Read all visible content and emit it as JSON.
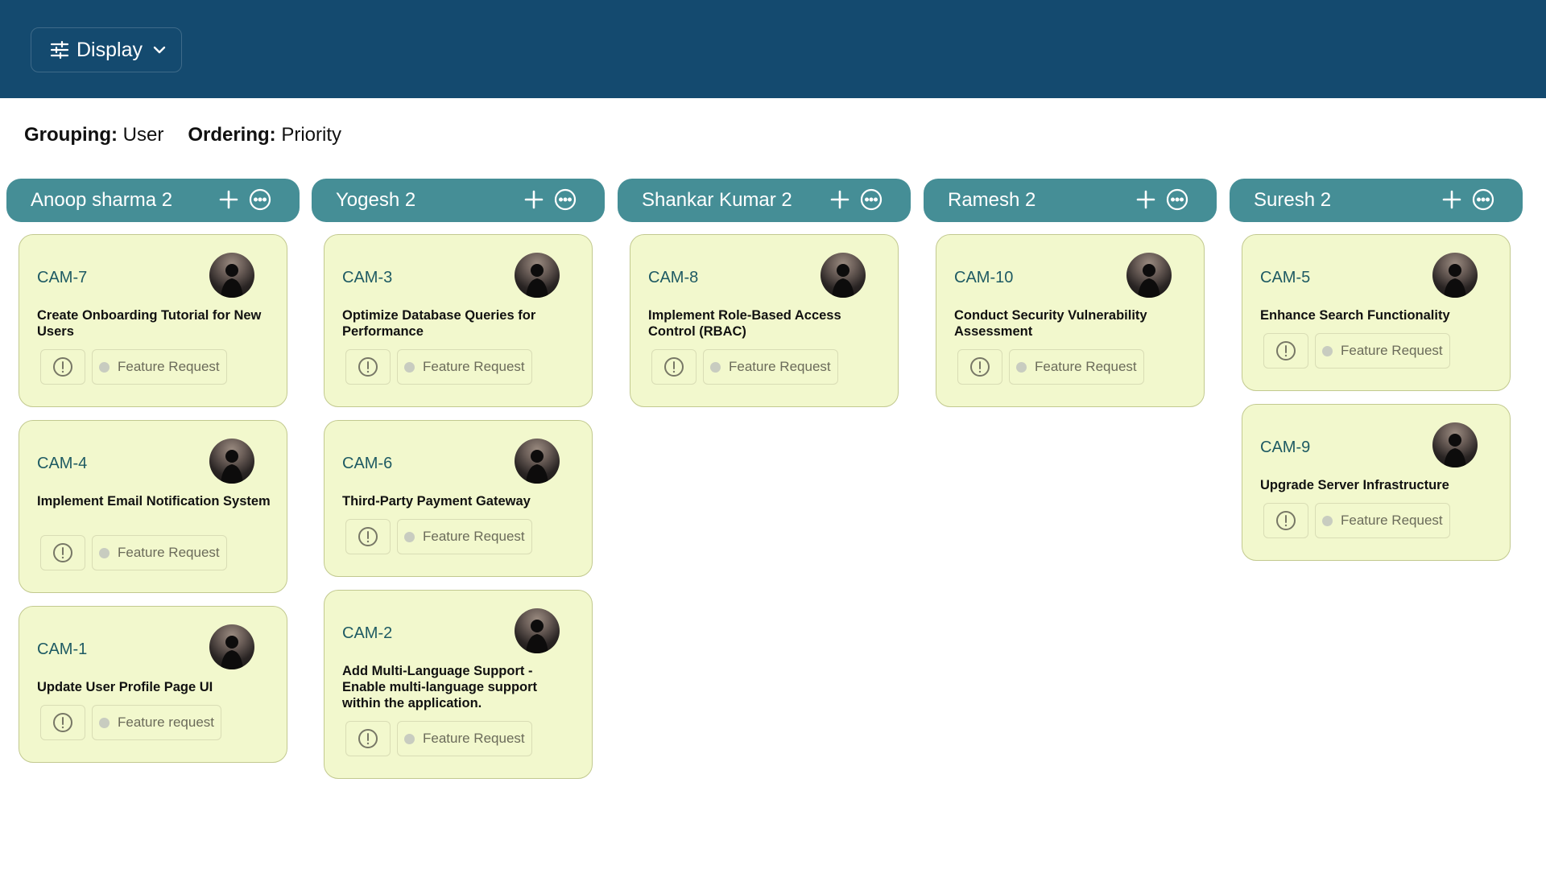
{
  "toolbar": {
    "display_label": "Display"
  },
  "filters": {
    "grouping_label": "Grouping:",
    "grouping_value": "User",
    "ordering_label": "Ordering:",
    "ordering_value": "Priority"
  },
  "columns": [
    {
      "title": "Anoop sharma 2",
      "cards": [
        {
          "id": "CAM-7",
          "title": "Create Onboarding Tutorial for New Users",
          "tag": "Feature Request"
        },
        {
          "id": "CAM-4",
          "title": "Implement Email Notification System",
          "tag": "Feature Request"
        },
        {
          "id": "CAM-1",
          "title": "Update User Profile Page UI",
          "tag": "Feature request"
        }
      ]
    },
    {
      "title": "Yogesh 2",
      "cards": [
        {
          "id": "CAM-3",
          "title": "Optimize Database Queries for Performance",
          "tag": "Feature Request"
        },
        {
          "id": "CAM-6",
          "title": "Third-Party Payment Gateway",
          "tag": "Feature Request"
        },
        {
          "id": "CAM-2",
          "title": "Add Multi-Language Support - Enable multi-language support within the application.",
          "tag": "Feature Request"
        }
      ]
    },
    {
      "title": "Shankar Kumar 2",
      "cards": [
        {
          "id": "CAM-8",
          "title": "Implement Role-Based Access Control (RBAC)",
          "tag": "Feature Request"
        }
      ]
    },
    {
      "title": "Ramesh 2",
      "cards": [
        {
          "id": "CAM-10",
          "title": "Conduct Security Vulnerability Assessment",
          "tag": "Feature Request"
        }
      ]
    },
    {
      "title": "Suresh 2",
      "cards": [
        {
          "id": "CAM-5",
          "title": "Enhance Search Functionality",
          "tag": "Feature Request"
        },
        {
          "id": "CAM-9",
          "title": "Upgrade Server Infrastructure",
          "tag": "Feature Request"
        }
      ]
    }
  ],
  "icons": {
    "display_button": "sliders-icon",
    "display_chevron": "chevron-down-icon",
    "column_add": "plus-icon",
    "column_more": "more-options-icon",
    "priority": "exclamation-circle-icon",
    "avatar": "user-avatar"
  },
  "colors": {
    "topbar": "#144a6f",
    "column_header": "#458e96",
    "card_background": "#f2f8cd",
    "card_id": "#1e5a63"
  }
}
